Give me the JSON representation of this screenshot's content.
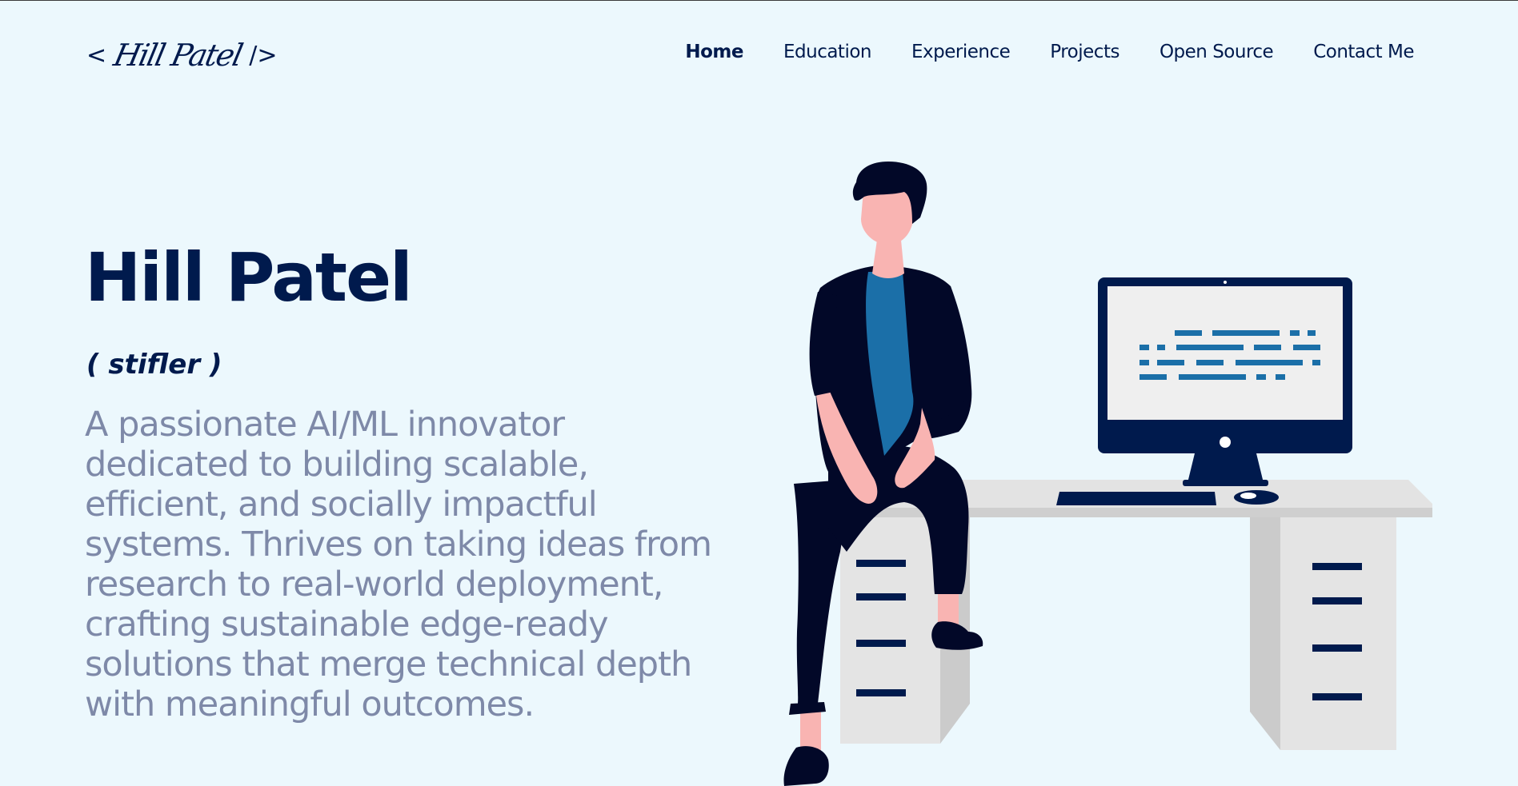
{
  "header": {
    "logo_open": "<",
    "logo_name": "Hill Patel",
    "logo_close": "/>",
    "nav": [
      {
        "label": "Home",
        "active": true
      },
      {
        "label": "Education",
        "active": false
      },
      {
        "label": "Experience",
        "active": false
      },
      {
        "label": "Projects",
        "active": false
      },
      {
        "label": "Open Source",
        "active": false
      },
      {
        "label": "Contact Me",
        "active": false
      }
    ]
  },
  "hero": {
    "name": "Hill Patel",
    "nickname": "( stifler )",
    "bio": "A passionate AI/ML innovator dedicated to building scalable, efficient, and socially impactful systems. Thrives on taking ideas from research to real-world deployment, crafting sustainable edge-ready solutions that merge technical depth with meaningful outcomes."
  },
  "colors": {
    "background": "#ecf8fd",
    "primary": "#001a4d",
    "muted_text": "#7e89a8",
    "accent_blue": "#1b6fa8",
    "skin": "#f9b4b2"
  },
  "illustration": {
    "icon": "developer-at-desk-illustration"
  }
}
